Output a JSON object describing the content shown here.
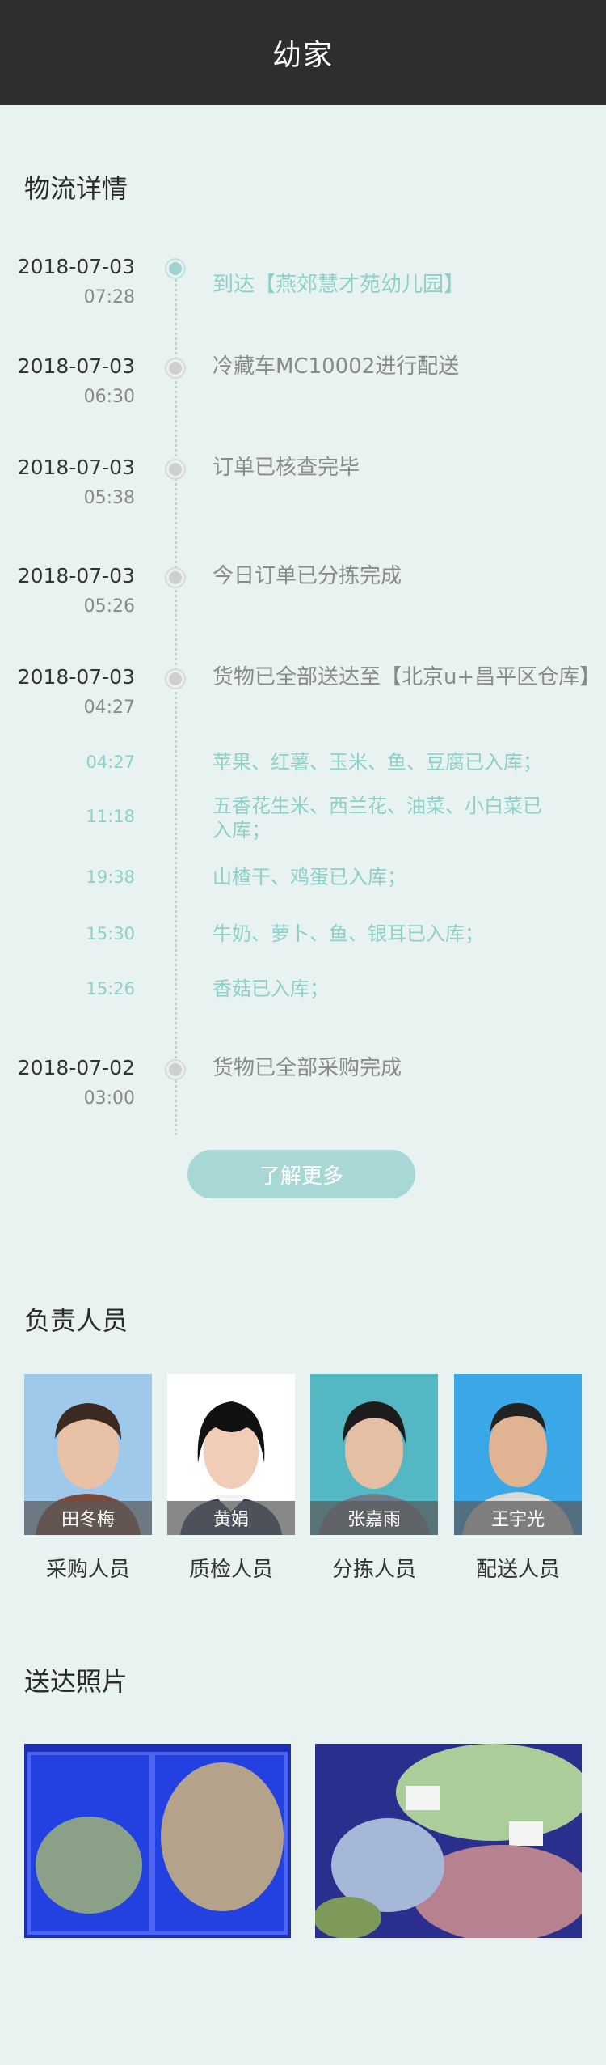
{
  "header": {
    "title": "幼家"
  },
  "logistics": {
    "title": "物流详情",
    "events": [
      {
        "date": "2018-07-03",
        "time": "07:28",
        "text": "到达【燕郊慧才苑幼儿园】"
      },
      {
        "date": "2018-07-03",
        "time": "06:30",
        "text": "冷藏车MC10002进行配送"
      },
      {
        "date": "2018-07-03",
        "time": "05:38",
        "text": "订单已核查完毕"
      },
      {
        "date": "2018-07-03",
        "time": "05:26",
        "text": "今日订单已分拣完成"
      },
      {
        "date": "2018-07-03",
        "time": "04:27",
        "text": "货物已全部送达至【北京u+昌平区仓库】"
      },
      {
        "date": "2018-07-02",
        "time": "03:00",
        "text": "货物已全部采购完成"
      }
    ],
    "sub_events": [
      {
        "time": "04:27",
        "text": "苹果、红薯、玉米、鱼、豆腐已入库；"
      },
      {
        "time": "11:18",
        "text": "五香花生米、西兰花、油菜、小白菜已入库；"
      },
      {
        "time": "19:38",
        "text": "山楂干、鸡蛋已入库；"
      },
      {
        "time": "15:30",
        "text": "牛奶、萝卜、鱼、银耳已入库；"
      },
      {
        "time": "15:26",
        "text": "香菇已入库；"
      }
    ],
    "more_label": "了解更多"
  },
  "staff": {
    "title": "负责人员",
    "members": [
      {
        "name": "田冬梅",
        "role": "采购人员"
      },
      {
        "name": "黄娟",
        "role": "质检人员"
      },
      {
        "name": "张嘉雨",
        "role": "分拣人员"
      },
      {
        "name": "王宇光",
        "role": "配送人员"
      }
    ]
  },
  "delivery_photos": {
    "title": "送达照片"
  },
  "colors": {
    "accent": "#8fcfc9",
    "header_bg": "#2e2e30",
    "page_bg": "#e8f3f1"
  }
}
